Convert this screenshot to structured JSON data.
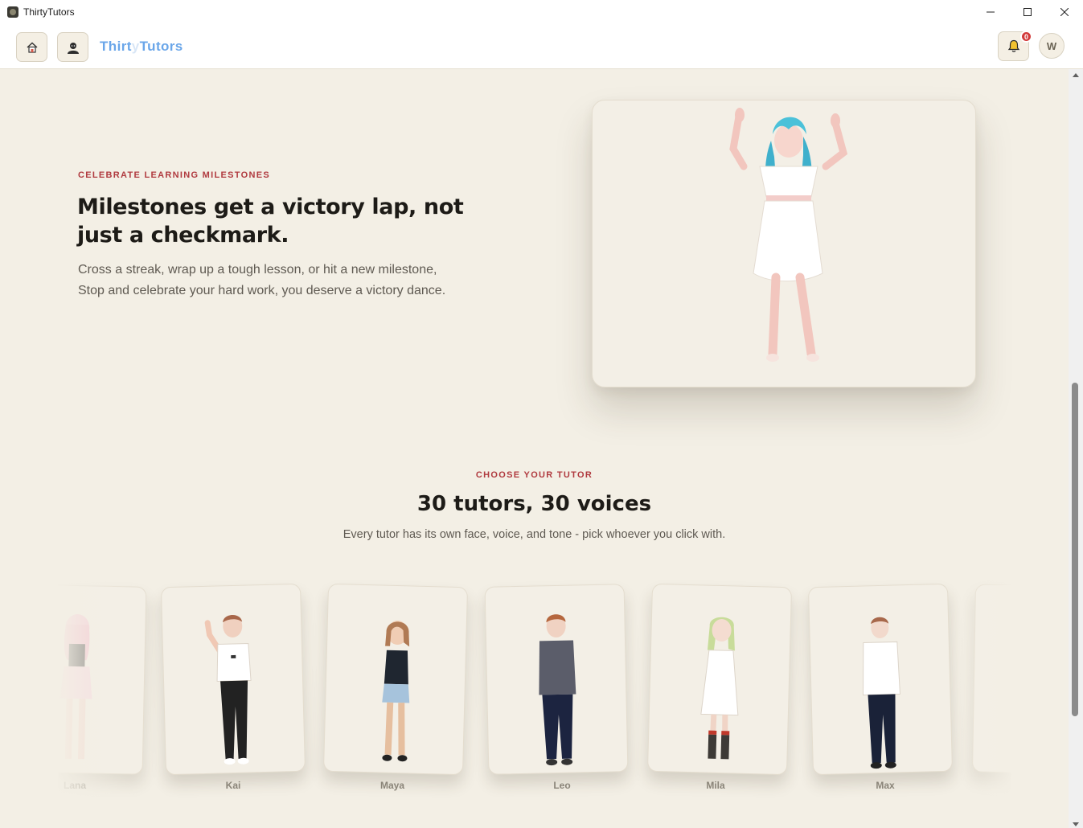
{
  "window": {
    "title": "ThirtyTutors"
  },
  "header": {
    "brand_part1": "Thirt",
    "brand_part2": "y",
    "brand_part3": "Tutors",
    "notification_count": "0",
    "avatar_initial": "W"
  },
  "milestones": {
    "eyebrow": "CELEBRATE LEARNING MILESTONES",
    "title": "Milestones get a victory lap, not just a checkmark.",
    "body": "Cross a streak, wrap up a tough lesson, or hit a new milestone, Stop and celebrate your hard work, you deserve a victory dance."
  },
  "tutors": {
    "eyebrow": "CHOOSE YOUR TUTOR",
    "title": "30 tutors, 30 voices",
    "subtitle": "Every tutor has its own face, voice, and tone - pick whoever you click with.",
    "cards": [
      {
        "name": "Lana"
      },
      {
        "name": "Kai"
      },
      {
        "name": "Maya"
      },
      {
        "name": "Leo"
      },
      {
        "name": "Mila"
      },
      {
        "name": "Max"
      }
    ]
  },
  "colors": {
    "background": "#f3efe5",
    "accent": "#b03a3f",
    "brand": "#6aa6e9",
    "badge": "#d23b3b"
  },
  "icons": [
    "home-icon",
    "tutor-avatar-icon",
    "bell-icon",
    "minimize-icon",
    "maximize-icon",
    "close-icon"
  ]
}
